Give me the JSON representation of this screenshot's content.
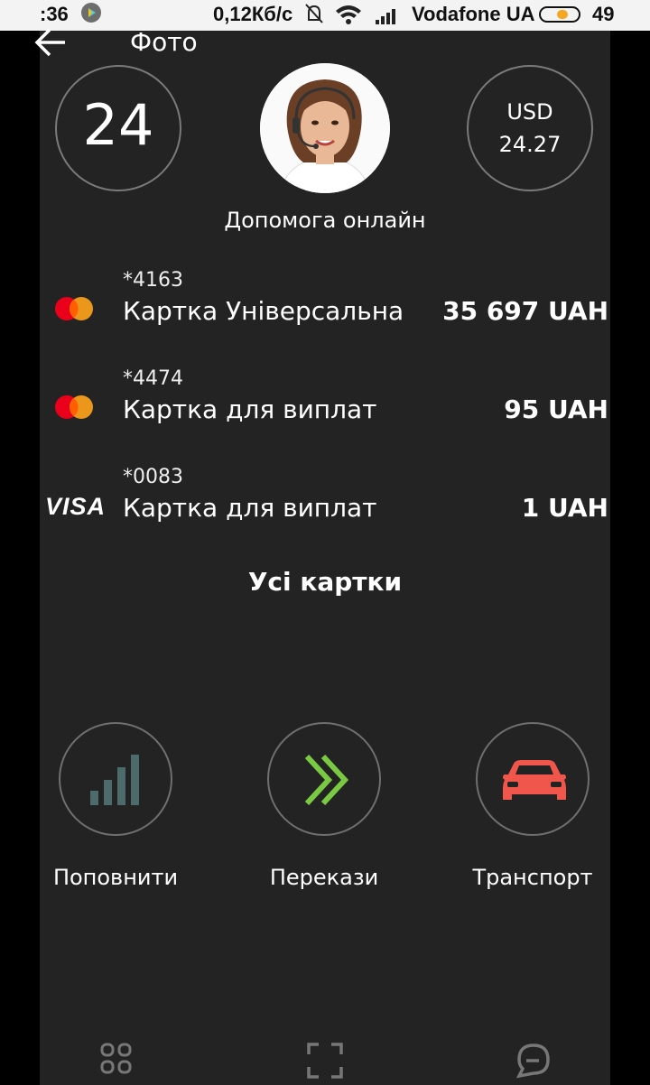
{
  "status_bar": {
    "time": ":36",
    "speed": "0,12Кб/с",
    "carrier": "Vodafone UA",
    "battery_pct": "49",
    "battery_level": 0.49
  },
  "header": {
    "title": "Фото",
    "back_icon": "arrow-left-icon"
  },
  "top_widgets": {
    "day_number": "24",
    "currency": "USD",
    "rate": "24.27",
    "help_label": "Допомога онлайн"
  },
  "cards": [
    {
      "brand": "mastercard",
      "number": "*4163",
      "name": "Картка Універсальна",
      "amount": "35 697 UAH"
    },
    {
      "brand": "mastercard",
      "number": "*4474",
      "name": "Картка для виплат",
      "amount": "95 UAH"
    },
    {
      "brand": "visa",
      "brand_label": "VISA",
      "number": "*0083",
      "name": "Картка для виплат",
      "amount": "1 UAH"
    }
  ],
  "all_cards_label": "Усі картки",
  "actions": [
    {
      "label": "Поповнити",
      "icon": "signal-bars-icon"
    },
    {
      "label": "Перекази",
      "icon": "double-chevron-right-icon"
    },
    {
      "label": "Транспорт",
      "icon": "car-icon"
    }
  ],
  "bottom_nav": [
    "grid-icon",
    "scan-icon",
    "chat-icon"
  ],
  "colors": {
    "background": "#232323",
    "mastercard_red": "#eb001b",
    "mastercard_orange": "#f79e1b",
    "transfer_green": "#7ac943",
    "transport_red": "#f0564c",
    "signal_gray": "#4e6b6b"
  }
}
